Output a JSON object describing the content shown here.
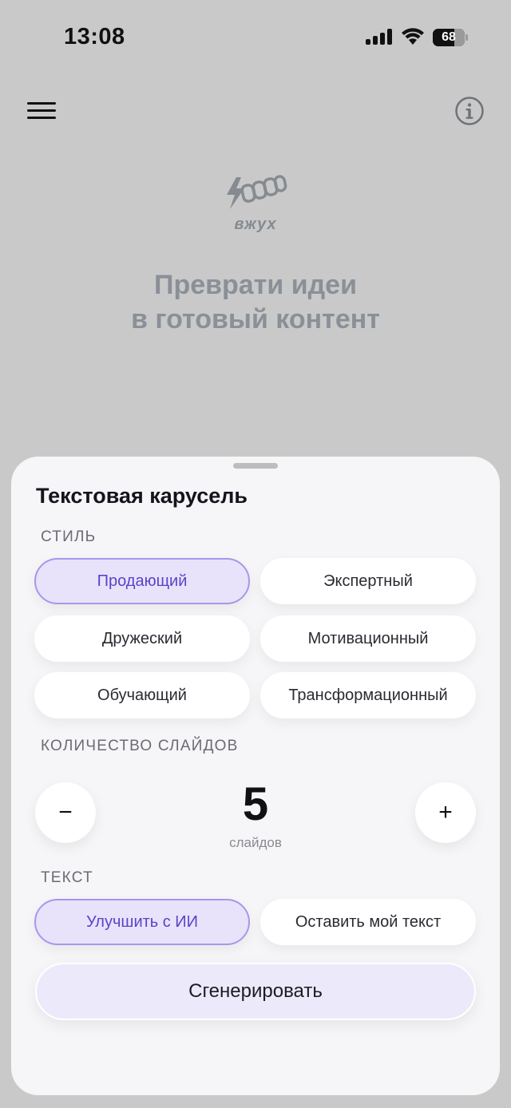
{
  "status_bar": {
    "time": "13:08",
    "battery_percent": 68,
    "battery_label": "68"
  },
  "header": {
    "menu_icon": "hamburger-menu-icon",
    "info_icon": "info-circle-icon"
  },
  "hero": {
    "logo_text": "вжух",
    "title_line1": "Преврати идеи",
    "title_line2": "в готовый контент"
  },
  "sheet": {
    "title": "Текстовая карусель",
    "style_section": {
      "label": "СТИЛЬ",
      "options": [
        {
          "label": "Продающий",
          "selected": true
        },
        {
          "label": "Экспертный",
          "selected": false
        },
        {
          "label": "Дружеский",
          "selected": false
        },
        {
          "label": "Мотивационный",
          "selected": false
        },
        {
          "label": "Обучающий",
          "selected": false
        },
        {
          "label": "Трансформационный",
          "selected": false
        }
      ]
    },
    "slides_section": {
      "label": "КОЛИЧЕСТВО СЛАЙДОВ",
      "minus_label": "−",
      "plus_label": "+",
      "value": "5",
      "unit": "слайдов"
    },
    "text_section": {
      "label": "ТЕКСТ",
      "options": [
        {
          "label": "Улучшить с ИИ",
          "selected": true
        },
        {
          "label": "Оставить мой текст",
          "selected": false
        }
      ]
    },
    "generate_label": "Сгенерировать"
  },
  "colors": {
    "background": "#c9c9c9",
    "sheet": "#f6f6f8",
    "accent": "#5b43c8",
    "accent_light": "#e8e3fb",
    "muted_title": "#8a9097"
  }
}
